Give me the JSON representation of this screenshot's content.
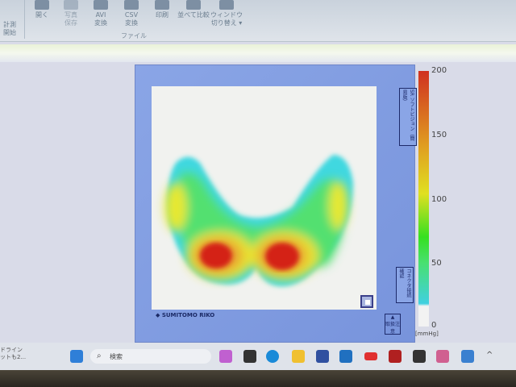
{
  "ribbon": {
    "buttons": [
      {
        "label": "計測\n開始",
        "icon": "record-icon"
      },
      {
        "label": "開く",
        "icon": "folder-icon"
      },
      {
        "label": "写真\n保存",
        "icon": "photo-icon"
      },
      {
        "label": "AVI\n変換",
        "icon": "avi-icon"
      },
      {
        "label": "CSV\n変換",
        "icon": "csv-icon"
      },
      {
        "label": "印刷",
        "icon": "printer-icon"
      },
      {
        "label": "並べて比較",
        "icon": "compare-icon"
      },
      {
        "label": "ウィンドウ\n切り替え ▾",
        "icon": "window-switch-icon"
      }
    ],
    "group_label": "ファイル"
  },
  "viewer": {
    "side_label_top": "SR ソフトビジョン（簡易版）",
    "side_label_bottom": "コネクタ接続確認",
    "logo": "SUMITOMO RIKO",
    "warning": "取扱注意"
  },
  "colorbar": {
    "ticks": [
      "200",
      "150",
      "100",
      "50",
      "0"
    ],
    "unit": "[mmHg]",
    "min": 0,
    "max": 200,
    "colors": {
      "low": "#40d0e0",
      "mid": "#e0e020",
      "high": "#d03020"
    }
  },
  "taskbar": {
    "search_placeholder": "検索",
    "desktop_text": "ドライン\nットも2..."
  }
}
